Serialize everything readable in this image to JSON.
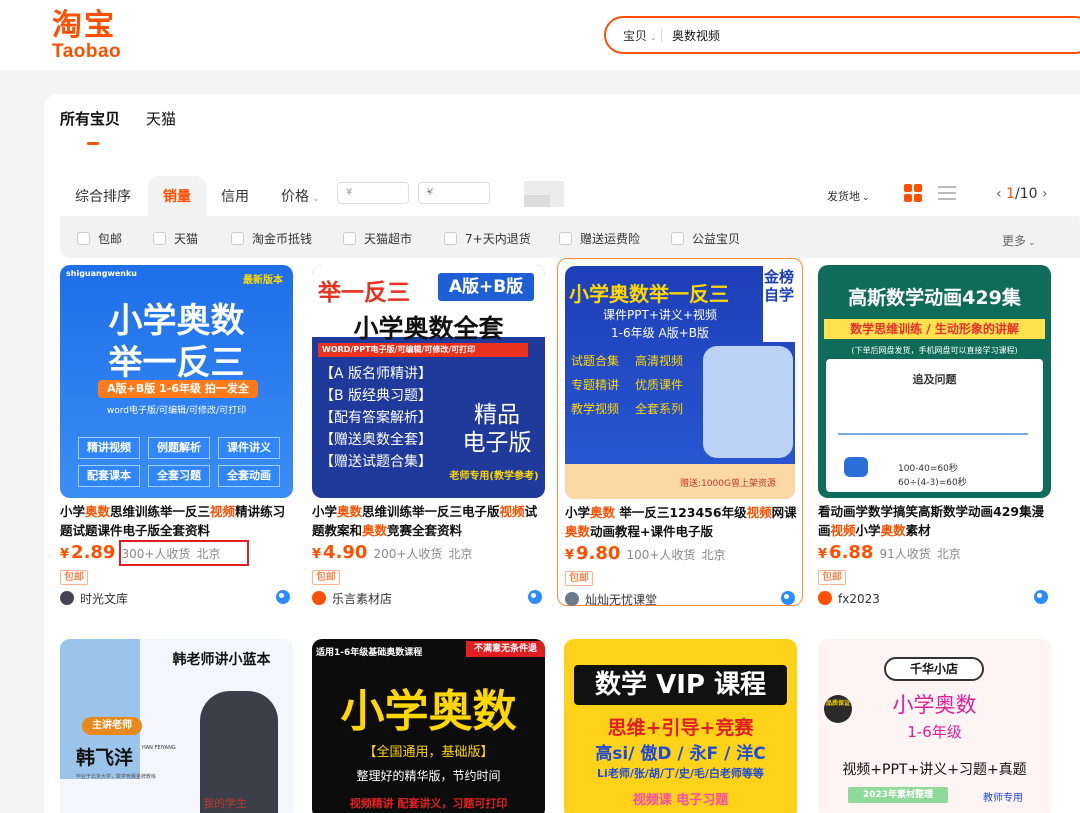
{
  "header": {
    "logo_cn": "淘宝",
    "logo_en": "Taobao",
    "search_category": "宝贝",
    "search_value": "奥数视频"
  },
  "scope_tabs": [
    {
      "label": "所有宝贝",
      "active": true
    },
    {
      "label": "天猫",
      "active": false
    }
  ],
  "sort": {
    "items": [
      "综合排序",
      "销量",
      "信用",
      "价格"
    ],
    "active": "销量",
    "price_min_placeholder": "¥",
    "price_max_placeholder": "¥",
    "dash": "-",
    "ship_from": "发货地",
    "page_current": "1",
    "page_total": "/10"
  },
  "filters": [
    "包邮",
    "天猫",
    "淘金币抵钱",
    "天猫超市",
    "7+天内退货",
    "赠送运费险",
    "公益宝贝"
  ],
  "more_label": "更多",
  "products": [
    {
      "title_parts": [
        "小学",
        "奥数",
        "思维训练举一反三",
        "视频",
        "精讲练习题试题课件电子版全套资料"
      ],
      "price": "2.89",
      "currency": "¥",
      "sold": "300+人收货",
      "location": "北京",
      "badge": "包邮",
      "shop": "时光文库",
      "thumb": [
        "shiguangwenku",
        "最新版本",
        "小学奥数",
        "举一反三",
        "A版+B版 1-6年级 拍一发全",
        "word电子版/可编辑/可修改/可打印",
        "精讲视频",
        "例题解析",
        "课件讲义",
        "配套课本",
        "全套习题",
        "全套动画"
      ]
    },
    {
      "title_parts": [
        "小学",
        "奥数",
        "思维训练举一反三电子版",
        "视频",
        "试题教案和",
        "奥数",
        "竞赛全套资料"
      ],
      "price": "4.90",
      "currency": "¥",
      "sold": "200+人收货",
      "location": "北京",
      "badge": "包邮",
      "shop": "乐言素材店",
      "thumb": [
        "举一反三",
        "A版+B版",
        "小学奥数全套",
        "WORD/PPT电子版/可编辑/可修改/可打印",
        "【A 版名师精讲】",
        "【B 版经典习题】",
        "【配有答案解析】",
        "【赠送奥数全套】",
        "【赠送试题合集】",
        "精品",
        "电子版",
        "老师专用(教学参考)"
      ]
    },
    {
      "title_parts": [
        "小学",
        "奥数",
        " 举一反三123456年级",
        "视频",
        "网课 ",
        "奥数",
        "动画教程+课件电子版"
      ],
      "price": "9.80",
      "currency": "¥",
      "sold": "100+人收货",
      "location": "北京",
      "badge": "包邮",
      "shop": "灿灿无忧课堂",
      "thumb": [
        "小学奥数举一反三",
        "课件PPT+讲义+视频",
        "1-6年级 A版+B版",
        "金榜自学",
        "试题合集",
        "高清视频",
        "专题精讲",
        "优质课件",
        "教学视频",
        "全套系列",
        "赠送:1000G曾上架资源"
      ]
    },
    {
      "title_parts": [
        "看动画学数学搞笑高斯数学动画429集漫画",
        "视频",
        "小学",
        "奥数",
        "素材"
      ],
      "price": "6.88",
      "currency": "¥",
      "sold": "91人收货",
      "location": "北京",
      "badge": "包邮",
      "shop": "fx2023",
      "thumb": [
        "高斯数学动画429集",
        "数学思维训练 / 生动形象的讲解",
        "(下单后网盘发货，手机网盘可以直接学习课程)",
        "追及问题",
        "100-40=60秒",
        "60÷(4-3)=60秒"
      ]
    }
  ],
  "products_row2": [
    {
      "thumb": [
        "韩老师讲小蓝本",
        "主讲老师",
        "韩飞洋",
        "HAN FEIYANG",
        "毕业于北京大学，数学竞赛金牌教练",
        "我的学生"
      ]
    },
    {
      "thumb": [
        "适用1-6年级基础奥数课程",
        "不满意无条件退",
        "小学奥数",
        "【全国通用，基础版】",
        "整理好的精华版，节约时间",
        "视频精讲  配套讲义，习题可打印"
      ]
    },
    {
      "thumb": [
        "数学 VIP 课程",
        "思维+引导+竞赛",
        "高si/ 傲D / 永F / 洋C",
        "Li老师/张/胡/丁/史/毛/白老师等等",
        "视频课  电子习题"
      ]
    },
    {
      "thumb": [
        "千华小店",
        "小学奥数",
        "1-6年级",
        "视频+PPT+讲义+习题+真题",
        "2023年素材整理",
        "教师专用",
        "品质保证"
      ]
    }
  ],
  "colors": {
    "brand": "#ff5000",
    "highlight_box": "#e02020"
  }
}
